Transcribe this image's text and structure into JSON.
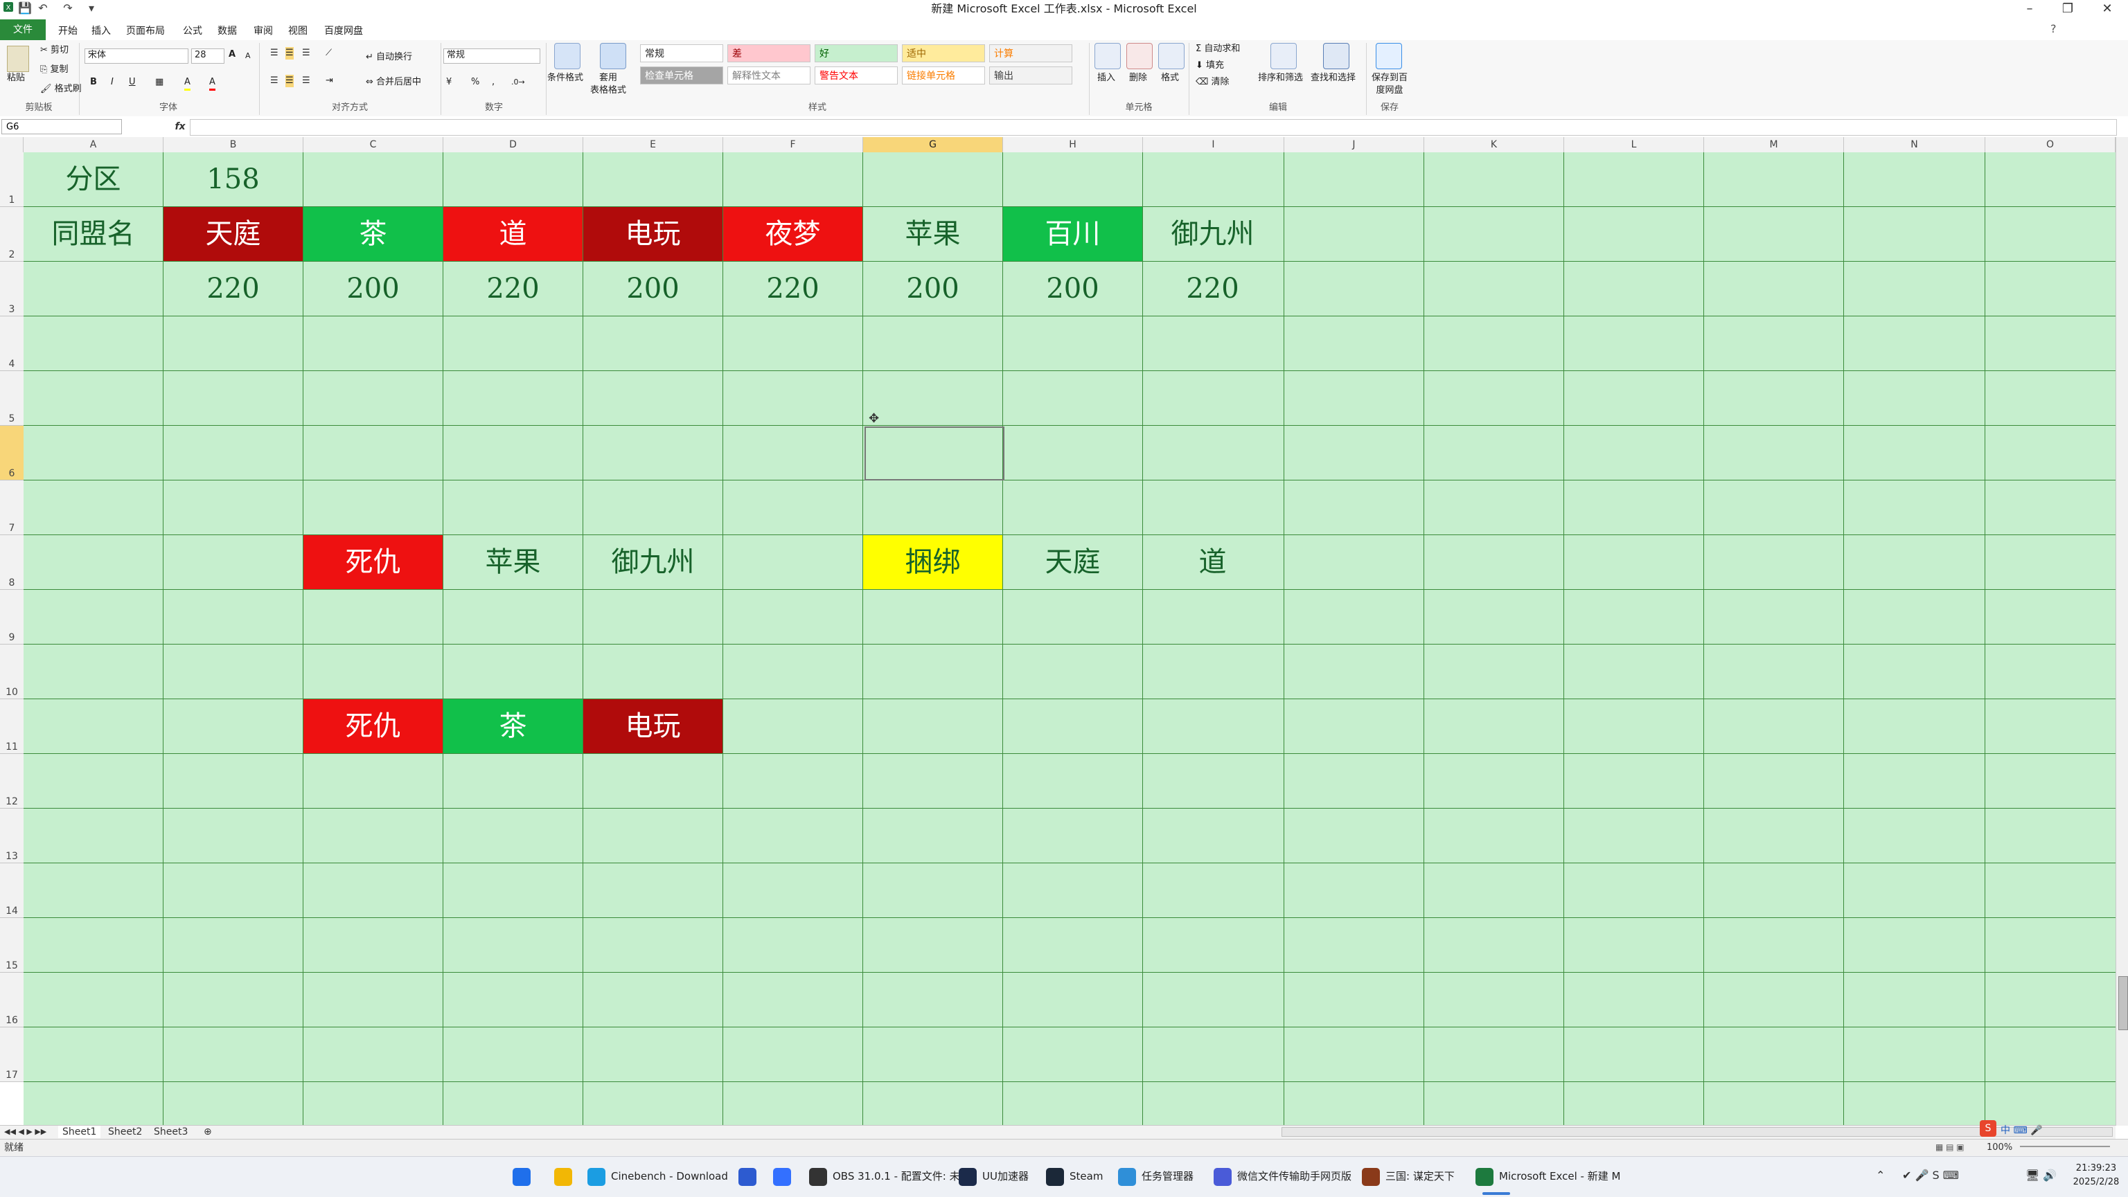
{
  "window": {
    "title": "新建 Microsoft Excel 工作表.xlsx - Microsoft Excel",
    "min_symbol": "–",
    "max_symbol": "❐",
    "close_symbol": "✕"
  },
  "qat": {
    "save": "💾",
    "undo": "↶",
    "redo": "↷",
    "more": "▾"
  },
  "tabs": [
    "开始",
    "插入",
    "页面布局",
    "公式",
    "数据",
    "审阅",
    "视图",
    "百度网盘"
  ],
  "file_tab": "文件",
  "ribbon": {
    "clipboard": {
      "paste": "粘贴",
      "cut": "剪切",
      "copy": "复制",
      "format_painter": "格式刷",
      "label": "剪贴板"
    },
    "font": {
      "name": "宋体",
      "size": "28",
      "bold": "B",
      "italic": "I",
      "underline": "U",
      "grow": "A",
      "shrink": "A",
      "fill_color": "A",
      "font_color": "A",
      "label": "字体"
    },
    "alignment": {
      "wrap": "自动换行",
      "merge": "合并后居中",
      "label": "对齐方式"
    },
    "number": {
      "format": "常规",
      "percent": "%",
      "comma": ",",
      "label": "数字"
    },
    "styles": {
      "conditional": "条件格式",
      "table": "套用\n表格格式",
      "cells": [
        {
          "text": "常规",
          "bg": "#ffffff",
          "color": "#222222"
        },
        {
          "text": "差",
          "bg": "#ffc7ce",
          "color": "#9c0006"
        },
        {
          "text": "好",
          "bg": "#c6efce",
          "color": "#006100"
        },
        {
          "text": "适中",
          "bg": "#ffeb9c",
          "color": "#9c6500"
        },
        {
          "text": "计算",
          "bg": "#f2f2f2",
          "color": "#fa7d00"
        },
        {
          "text": "检查单元格",
          "bg": "#a5a5a5",
          "color": "#ffffff"
        },
        {
          "text": "解释性文本",
          "bg": "#ffffff",
          "color": "#7f7f7f"
        },
        {
          "text": "警告文本",
          "bg": "#ffffff",
          "color": "#ff0000"
        },
        {
          "text": "链接单元格",
          "bg": "#ffffff",
          "color": "#fa7d00"
        },
        {
          "text": "输出",
          "bg": "#f2f2f2",
          "color": "#3f3f3f"
        }
      ],
      "label": "样式"
    },
    "cells_group": {
      "insert": "插入",
      "delete": "删除",
      "format": "格式",
      "label": "单元格"
    },
    "editing": {
      "autosum": "自动求和",
      "fill": "填充",
      "clear": "清除",
      "sort": "排序和筛选",
      "find": "查找和选择",
      "label": "编辑"
    },
    "save_group": {
      "save_to_pan": "保存到百度网盘",
      "label": "保存"
    }
  },
  "formula_bar": {
    "name_box": "G6",
    "fx": "fx",
    "value": ""
  },
  "columns": [
    "A",
    "B",
    "C",
    "D",
    "E",
    "F",
    "G",
    "H",
    "I",
    "J",
    "K",
    "L",
    "M",
    "N",
    "O"
  ],
  "selected_column": "G",
  "rows": [
    "1",
    "2",
    "3",
    "4",
    "5",
    "6",
    "7",
    "8",
    "9",
    "10",
    "11",
    "12",
    "13",
    "14",
    "15",
    "16",
    "17"
  ],
  "selected_row": "6",
  "cells": {
    "A1": "分区",
    "B1": "158",
    "A2": "同盟名",
    "B2": "天庭",
    "C2": "茶",
    "D2": "道",
    "E2": "电玩",
    "F2": "夜梦",
    "G2": "苹果",
    "H2": "百川",
    "I2": "御九州",
    "B3": "220",
    "C3": "200",
    "D3": "220",
    "E3": "200",
    "F3": "220",
    "G3": "200",
    "H3": "200",
    "I3": "220",
    "C8": "死仇",
    "D8": "苹果",
    "E8": "御九州",
    "G8": "捆绑",
    "H8": "天庭",
    "I8": "道",
    "C11": "死仇",
    "D11": "茶",
    "E11": "电玩"
  },
  "cell_fills": {
    "B2": "dred",
    "C2": "green",
    "D2": "red",
    "E2": "dred",
    "F2": "red",
    "H2": "green",
    "C8": "red",
    "G8": "yellow",
    "C11": "red",
    "D11": "green",
    "E11": "dred"
  },
  "colors": {
    "grid_bg": "#c6efce",
    "grid_line": "#3b8b3b",
    "cell_text": "#17622a",
    "red": "#ee1111",
    "dark_red": "#b00b0b",
    "green": "#11c04a",
    "yellow": "#ffff00"
  },
  "sheets": [
    "Sheet1",
    "Sheet2",
    "Sheet3"
  ],
  "status": {
    "ready": "就绪",
    "zoom": "100%"
  },
  "taskbar": {
    "items": [
      {
        "label": "",
        "icon": "windows-start-icon",
        "color": "#1f6feb"
      },
      {
        "label": "",
        "icon": "folder-icon",
        "color": "#f2b705"
      },
      {
        "label": "Cinebench - Download",
        "icon": "edge-icon",
        "color": "#1b9de2"
      },
      {
        "label": "",
        "icon": "store-icon",
        "color": "#2d5bd0"
      },
      {
        "label": "",
        "icon": "feishu-icon",
        "color": "#3370ff"
      },
      {
        "label": "OBS 31.0.1 - 配置文件: 未",
        "icon": "obs-icon",
        "color": "#333333"
      },
      {
        "label": "UU加速器",
        "icon": "uu-icon",
        "color": "#1b2a4a"
      },
      {
        "label": "Steam",
        "icon": "steam-icon",
        "color": "#1b2838"
      },
      {
        "label": "任务管理器",
        "icon": "task-manager-icon",
        "color": "#2f8fd8"
      },
      {
        "label": "微信文件传输助手网页版",
        "icon": "wechat-icon",
        "color": "#4a5bd8"
      },
      {
        "label": "三国: 谋定天下",
        "icon": "game-icon",
        "color": "#8a3a1a"
      },
      {
        "label": "Microsoft Excel - 新建 M",
        "icon": "excel-icon",
        "color": "#1d7a3e"
      }
    ],
    "tray": {
      "ime": "中",
      "time": "21:39:23",
      "date": "2025/2/28"
    }
  }
}
